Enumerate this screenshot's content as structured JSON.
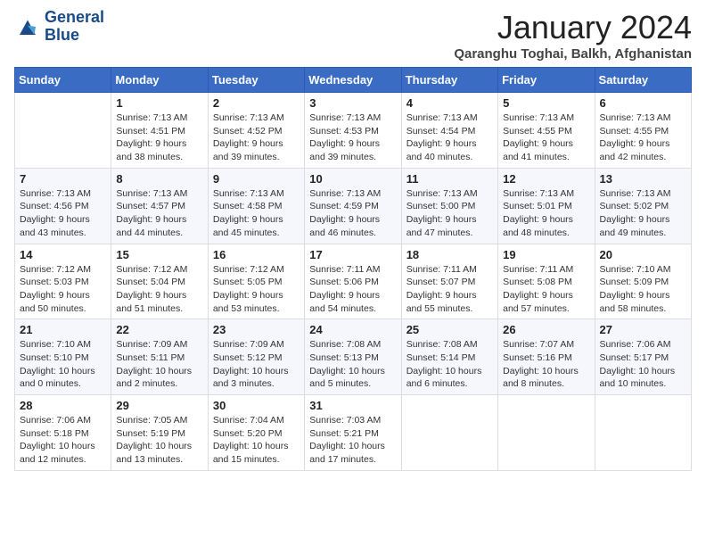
{
  "logo": {
    "line1": "General",
    "line2": "Blue"
  },
  "title": "January 2024",
  "location": "Qaranghu Toghai, Balkh, Afghanistan",
  "days_of_week": [
    "Sunday",
    "Monday",
    "Tuesday",
    "Wednesday",
    "Thursday",
    "Friday",
    "Saturday"
  ],
  "weeks": [
    [
      {
        "day": "",
        "sunrise": "",
        "sunset": "",
        "daylight": ""
      },
      {
        "day": "1",
        "sunrise": "Sunrise: 7:13 AM",
        "sunset": "Sunset: 4:51 PM",
        "daylight": "Daylight: 9 hours and 38 minutes."
      },
      {
        "day": "2",
        "sunrise": "Sunrise: 7:13 AM",
        "sunset": "Sunset: 4:52 PM",
        "daylight": "Daylight: 9 hours and 39 minutes."
      },
      {
        "day": "3",
        "sunrise": "Sunrise: 7:13 AM",
        "sunset": "Sunset: 4:53 PM",
        "daylight": "Daylight: 9 hours and 39 minutes."
      },
      {
        "day": "4",
        "sunrise": "Sunrise: 7:13 AM",
        "sunset": "Sunset: 4:54 PM",
        "daylight": "Daylight: 9 hours and 40 minutes."
      },
      {
        "day": "5",
        "sunrise": "Sunrise: 7:13 AM",
        "sunset": "Sunset: 4:55 PM",
        "daylight": "Daylight: 9 hours and 41 minutes."
      },
      {
        "day": "6",
        "sunrise": "Sunrise: 7:13 AM",
        "sunset": "Sunset: 4:55 PM",
        "daylight": "Daylight: 9 hours and 42 minutes."
      }
    ],
    [
      {
        "day": "7",
        "sunrise": "Sunrise: 7:13 AM",
        "sunset": "Sunset: 4:56 PM",
        "daylight": "Daylight: 9 hours and 43 minutes."
      },
      {
        "day": "8",
        "sunrise": "Sunrise: 7:13 AM",
        "sunset": "Sunset: 4:57 PM",
        "daylight": "Daylight: 9 hours and 44 minutes."
      },
      {
        "day": "9",
        "sunrise": "Sunrise: 7:13 AM",
        "sunset": "Sunset: 4:58 PM",
        "daylight": "Daylight: 9 hours and 45 minutes."
      },
      {
        "day": "10",
        "sunrise": "Sunrise: 7:13 AM",
        "sunset": "Sunset: 4:59 PM",
        "daylight": "Daylight: 9 hours and 46 minutes."
      },
      {
        "day": "11",
        "sunrise": "Sunrise: 7:13 AM",
        "sunset": "Sunset: 5:00 PM",
        "daylight": "Daylight: 9 hours and 47 minutes."
      },
      {
        "day": "12",
        "sunrise": "Sunrise: 7:13 AM",
        "sunset": "Sunset: 5:01 PM",
        "daylight": "Daylight: 9 hours and 48 minutes."
      },
      {
        "day": "13",
        "sunrise": "Sunrise: 7:13 AM",
        "sunset": "Sunset: 5:02 PM",
        "daylight": "Daylight: 9 hours and 49 minutes."
      }
    ],
    [
      {
        "day": "14",
        "sunrise": "Sunrise: 7:12 AM",
        "sunset": "Sunset: 5:03 PM",
        "daylight": "Daylight: 9 hours and 50 minutes."
      },
      {
        "day": "15",
        "sunrise": "Sunrise: 7:12 AM",
        "sunset": "Sunset: 5:04 PM",
        "daylight": "Daylight: 9 hours and 51 minutes."
      },
      {
        "day": "16",
        "sunrise": "Sunrise: 7:12 AM",
        "sunset": "Sunset: 5:05 PM",
        "daylight": "Daylight: 9 hours and 53 minutes."
      },
      {
        "day": "17",
        "sunrise": "Sunrise: 7:11 AM",
        "sunset": "Sunset: 5:06 PM",
        "daylight": "Daylight: 9 hours and 54 minutes."
      },
      {
        "day": "18",
        "sunrise": "Sunrise: 7:11 AM",
        "sunset": "Sunset: 5:07 PM",
        "daylight": "Daylight: 9 hours and 55 minutes."
      },
      {
        "day": "19",
        "sunrise": "Sunrise: 7:11 AM",
        "sunset": "Sunset: 5:08 PM",
        "daylight": "Daylight: 9 hours and 57 minutes."
      },
      {
        "day": "20",
        "sunrise": "Sunrise: 7:10 AM",
        "sunset": "Sunset: 5:09 PM",
        "daylight": "Daylight: 9 hours and 58 minutes."
      }
    ],
    [
      {
        "day": "21",
        "sunrise": "Sunrise: 7:10 AM",
        "sunset": "Sunset: 5:10 PM",
        "daylight": "Daylight: 10 hours and 0 minutes."
      },
      {
        "day": "22",
        "sunrise": "Sunrise: 7:09 AM",
        "sunset": "Sunset: 5:11 PM",
        "daylight": "Daylight: 10 hours and 2 minutes."
      },
      {
        "day": "23",
        "sunrise": "Sunrise: 7:09 AM",
        "sunset": "Sunset: 5:12 PM",
        "daylight": "Daylight: 10 hours and 3 minutes."
      },
      {
        "day": "24",
        "sunrise": "Sunrise: 7:08 AM",
        "sunset": "Sunset: 5:13 PM",
        "daylight": "Daylight: 10 hours and 5 minutes."
      },
      {
        "day": "25",
        "sunrise": "Sunrise: 7:08 AM",
        "sunset": "Sunset: 5:14 PM",
        "daylight": "Daylight: 10 hours and 6 minutes."
      },
      {
        "day": "26",
        "sunrise": "Sunrise: 7:07 AM",
        "sunset": "Sunset: 5:16 PM",
        "daylight": "Daylight: 10 hours and 8 minutes."
      },
      {
        "day": "27",
        "sunrise": "Sunrise: 7:06 AM",
        "sunset": "Sunset: 5:17 PM",
        "daylight": "Daylight: 10 hours and 10 minutes."
      }
    ],
    [
      {
        "day": "28",
        "sunrise": "Sunrise: 7:06 AM",
        "sunset": "Sunset: 5:18 PM",
        "daylight": "Daylight: 10 hours and 12 minutes."
      },
      {
        "day": "29",
        "sunrise": "Sunrise: 7:05 AM",
        "sunset": "Sunset: 5:19 PM",
        "daylight": "Daylight: 10 hours and 13 minutes."
      },
      {
        "day": "30",
        "sunrise": "Sunrise: 7:04 AM",
        "sunset": "Sunset: 5:20 PM",
        "daylight": "Daylight: 10 hours and 15 minutes."
      },
      {
        "day": "31",
        "sunrise": "Sunrise: 7:03 AM",
        "sunset": "Sunset: 5:21 PM",
        "daylight": "Daylight: 10 hours and 17 minutes."
      },
      {
        "day": "",
        "sunrise": "",
        "sunset": "",
        "daylight": ""
      },
      {
        "day": "",
        "sunrise": "",
        "sunset": "",
        "daylight": ""
      },
      {
        "day": "",
        "sunrise": "",
        "sunset": "",
        "daylight": ""
      }
    ]
  ]
}
